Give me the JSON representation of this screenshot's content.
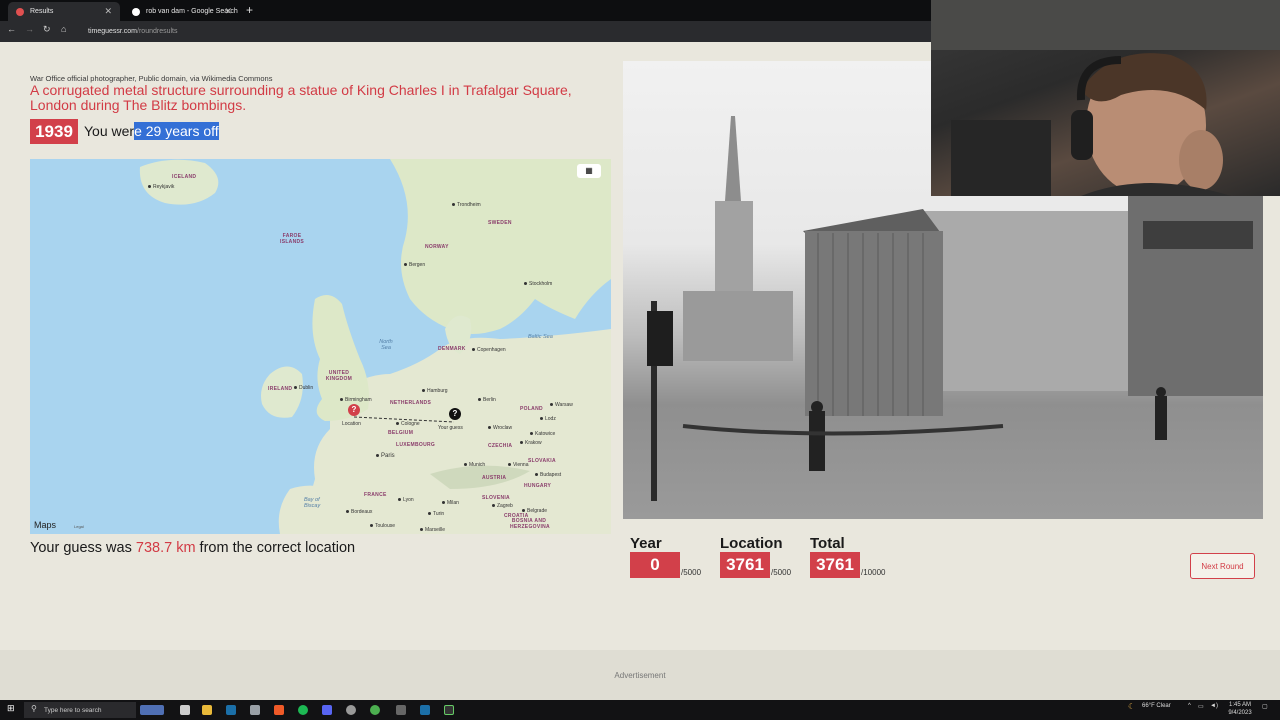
{
  "browser": {
    "tabs": [
      {
        "label": "Results",
        "active": true
      },
      {
        "label": "rob van dam - Google Search",
        "active": false
      }
    ],
    "url_host": "timeguessr.com",
    "url_path": "/roundresults"
  },
  "round": {
    "credit": "War Office official photographer, Public domain, via Wikimedia Commons",
    "description": "A corrugated metal structure surrounding a statue of King Charles I in Trafalgar Square, London during The Blitz bombings.",
    "year": "1939",
    "you_were_prefix": "You wer",
    "you_were_highlight": "e 29 years off",
    "guess_prefix": "Your guess was ",
    "guess_km": "738.7 km",
    "guess_suffix": " from the correct location"
  },
  "map": {
    "provider": "Maps",
    "legal": "Legal",
    "location_label": "Location",
    "guess_label": "Your guess",
    "countries": [
      "ICELAND",
      "FAROE ISLANDS",
      "NORWAY",
      "SWEDEN",
      "DENMARK",
      "UNITED KINGDOM",
      "IRELAND",
      "NETHERLANDS",
      "BELGIUM",
      "LUXEMBOURG",
      "POLAND",
      "CZECHIA",
      "FRANCE",
      "AUSTRIA",
      "SLOVAKIA",
      "HUNGARY",
      "SLOVENIA",
      "CROATIA",
      "BOSNIA AND HERZEGOVINA"
    ],
    "cities": [
      "Reykjavik",
      "Trondheim",
      "Bergen",
      "Stockholm",
      "Copenhagen",
      "Hamburg",
      "Berlin",
      "Warsaw",
      "Lodz",
      "Wroclaw",
      "Katowice",
      "Krakow",
      "Dublin",
      "Birmingham",
      "London",
      "Cologne",
      "Paris",
      "Munich",
      "Vienna",
      "Budapest",
      "Lyon",
      "Milan",
      "Turin",
      "Bordeaux",
      "Toulouse",
      "Marseille",
      "Belgrade",
      "Zagreb"
    ],
    "seas": [
      "North Sea",
      "Bay of Biscay",
      "Baltic Sea"
    ]
  },
  "scores": [
    {
      "title": "Year",
      "value": "0",
      "max": "/5000"
    },
    {
      "title": "Location",
      "value": "3761",
      "max": "/5000"
    },
    {
      "title": "Total",
      "value": "3761",
      "max": "/10000"
    }
  ],
  "next_round": "Next Round",
  "advertisement": "Advertisement",
  "taskbar": {
    "search_placeholder": "Type here to search",
    "weather": "66°F  Clear",
    "time": "1:45 AM",
    "date": "9/4/2023"
  },
  "colors": {
    "accent": "#d2404a",
    "highlight": "#3470d6",
    "page_bg": "#e9e7dd"
  }
}
